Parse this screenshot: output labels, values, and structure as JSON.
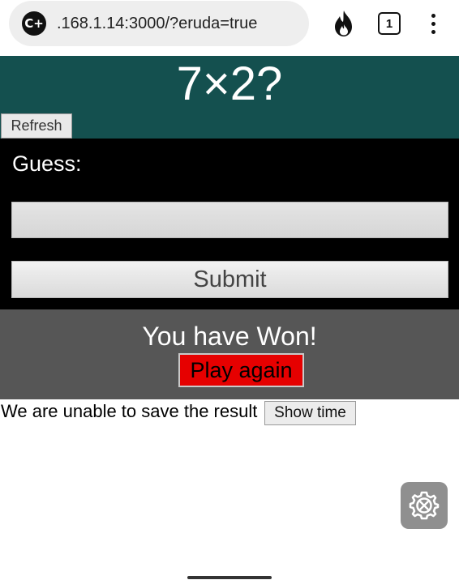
{
  "browser": {
    "site_icon_text": "C+",
    "url": ".168.1.14:3000/?eruda=true",
    "tab_count": "1",
    "icons": [
      "fire-icon",
      "tabs-icon",
      "more-menu-icon"
    ]
  },
  "quiz": {
    "question": "7×2?",
    "refresh_label": "Refresh"
  },
  "guess_form": {
    "label": "Guess:",
    "input_value": "",
    "submit_label": "Submit"
  },
  "result": {
    "message": "You have Won!",
    "play_again_label": "Play again"
  },
  "save": {
    "status_text": "We are unable to save the result",
    "show_time_label": "Show time"
  },
  "devtools": {
    "icon": "eruda-settings-icon"
  },
  "colors": {
    "question_bg": "#14504f",
    "form_bg": "#000000",
    "result_bg": "#565656",
    "play_again_bg": "#e60000"
  }
}
